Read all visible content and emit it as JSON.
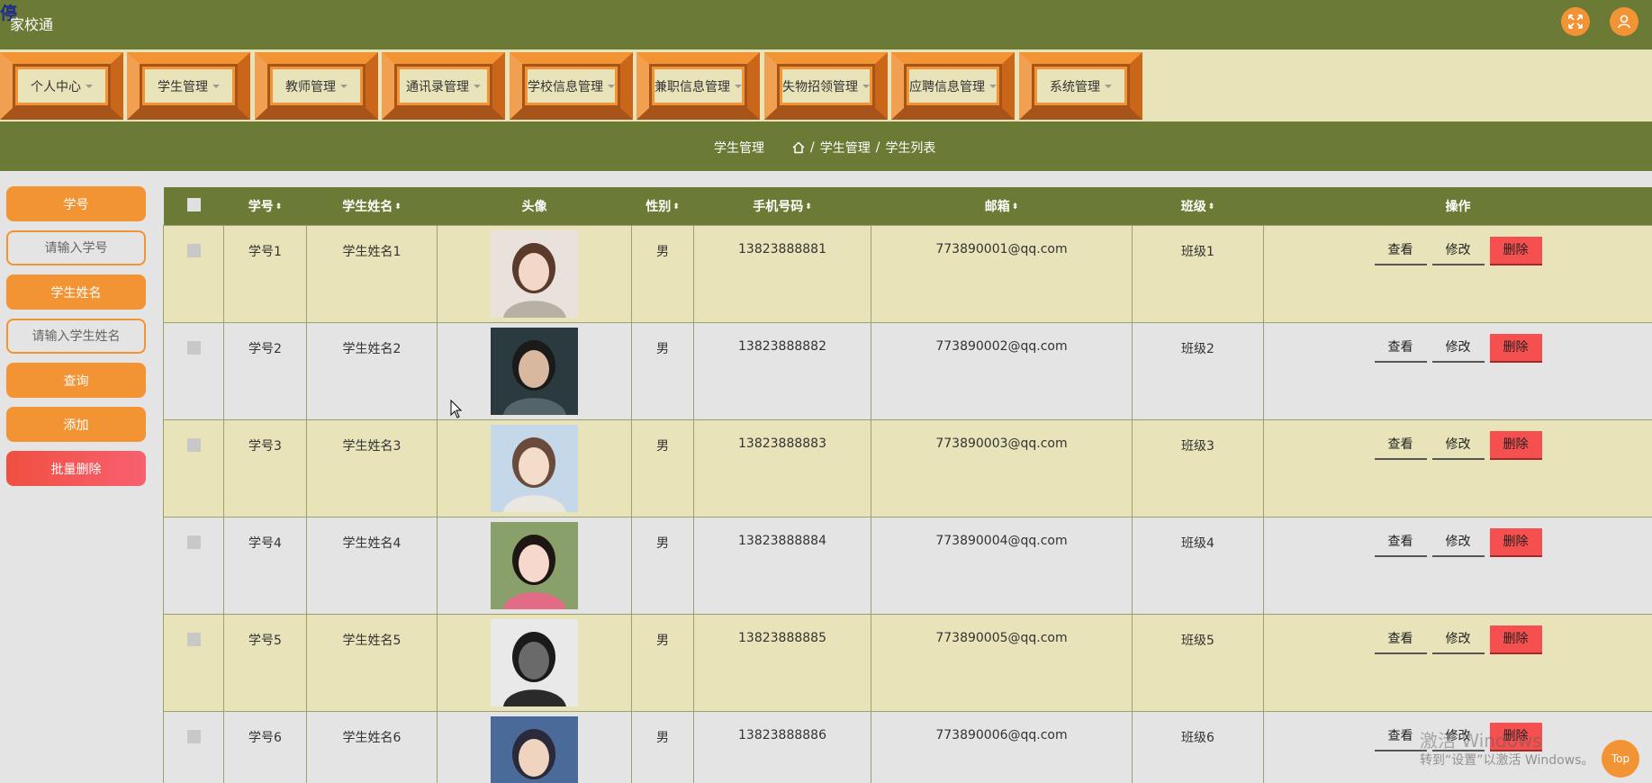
{
  "app": {
    "logo_mark": "停",
    "title": "家校通"
  },
  "header_icons": [
    "fullscreen-icon",
    "user-icon"
  ],
  "nav": [
    {
      "label": "个人中心"
    },
    {
      "label": "学生管理"
    },
    {
      "label": "教师管理"
    },
    {
      "label": "通讯录管理"
    },
    {
      "label": "学校信息管理"
    },
    {
      "label": "兼职信息管理"
    },
    {
      "label": "失物招领管理"
    },
    {
      "label": "应聘信息管理"
    },
    {
      "label": "系统管理"
    }
  ],
  "breadcrumb": {
    "title": "学生管理",
    "home_icon": "home-icon",
    "sep": "/",
    "level1": "学生管理",
    "level2": "学生列表"
  },
  "sidebar": {
    "id_label": "学号",
    "id_placeholder": "请输入学号",
    "name_label": "学生姓名",
    "name_placeholder": "请输入学生姓名",
    "query": "查询",
    "add": "添加",
    "batch_delete": "批量删除"
  },
  "table": {
    "columns": [
      "学号",
      "学生姓名",
      "头像",
      "性别",
      "手机号码",
      "邮箱",
      "班级",
      "操作"
    ],
    "rows": [
      {
        "id": "学号1",
        "name": "学生姓名1",
        "gender": "男",
        "phone": "13823888881",
        "email": "773890001@qq.com",
        "class": "班级1"
      },
      {
        "id": "学号2",
        "name": "学生姓名2",
        "gender": "男",
        "phone": "13823888882",
        "email": "773890002@qq.com",
        "class": "班级2"
      },
      {
        "id": "学号3",
        "name": "学生姓名3",
        "gender": "男",
        "phone": "13823888883",
        "email": "773890003@qq.com",
        "class": "班级3"
      },
      {
        "id": "学号4",
        "name": "学生姓名4",
        "gender": "男",
        "phone": "13823888884",
        "email": "773890004@qq.com",
        "class": "班级4"
      },
      {
        "id": "学号5",
        "name": "学生姓名5",
        "gender": "男",
        "phone": "13823888885",
        "email": "773890005@qq.com",
        "class": "班级5"
      },
      {
        "id": "学号6",
        "name": "学生姓名6",
        "gender": "男",
        "phone": "13823888886",
        "email": "773890006@qq.com",
        "class": "班级6"
      }
    ],
    "actions": {
      "view": "查看",
      "edit": "修改",
      "delete": "删除"
    }
  },
  "watermark": {
    "line1": "激活 Windows",
    "line2": "转到“设置”以激活 Windows。"
  },
  "top_button": "Top",
  "colors": {
    "header": "#6b7a35",
    "accent": "#f39434",
    "row_alt": "#e8e3b8",
    "danger": "#f5504f"
  }
}
